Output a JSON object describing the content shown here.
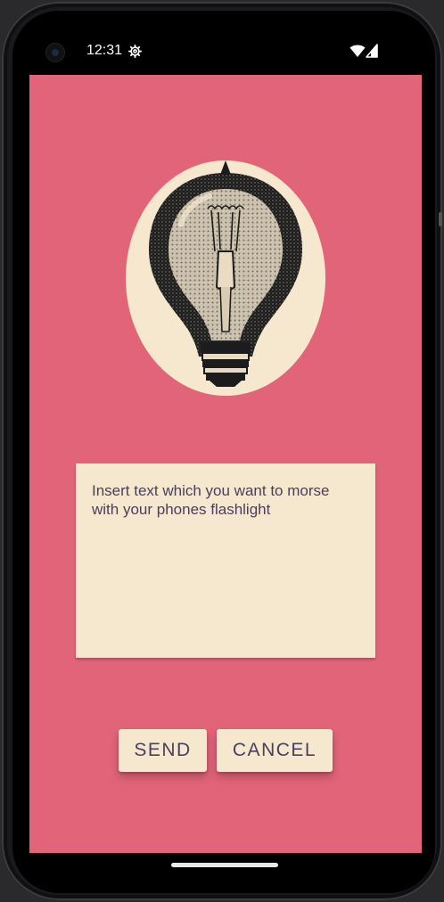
{
  "status_bar": {
    "time": "12:31",
    "settings_icon": "gear-icon",
    "wifi_icon": "wifi-icon",
    "signal_icon": "signal-icon"
  },
  "app": {
    "background_color": "#e26479",
    "surface_color": "#f5e8cf",
    "text_color": "#4a3f5c",
    "illustration": "light-bulb-illustration",
    "morse_input": {
      "value": "",
      "placeholder": "Insert text which you want to morse with your phones flashlight"
    },
    "buttons": {
      "send_label": "SEND",
      "cancel_label": "CANCEL"
    }
  }
}
